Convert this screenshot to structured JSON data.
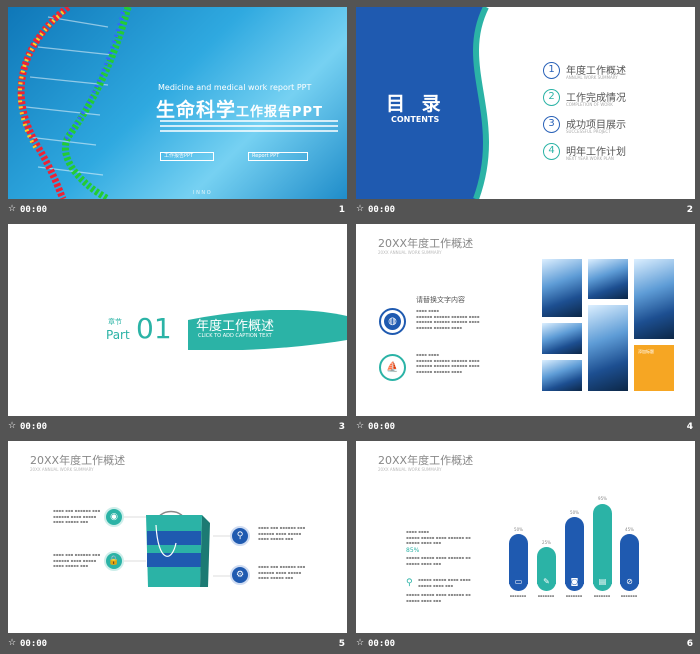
{
  "slides": [
    {
      "number": "1",
      "time": "00:00",
      "en_title": "Medicine and medical work report PPT",
      "zh_title_big": "生命科学",
      "zh_title_small": "工作报告PPT",
      "button_1": "工作报告PPT",
      "button_2": "Report PPT",
      "footer": "I N N O"
    },
    {
      "number": "2",
      "time": "00:00",
      "title": "目 录",
      "subtitle": "CONTENTS",
      "items": [
        {
          "num": "1",
          "label": "年度工作概述",
          "sub": "ANNUAL WORK SUMMARY"
        },
        {
          "num": "2",
          "label": "工作完成情况",
          "sub": "COMPLETION OF WORK"
        },
        {
          "num": "3",
          "label": "成功项目展示",
          "sub": "SUCCESSFUL PROJECT"
        },
        {
          "num": "4",
          "label": "明年工作计划",
          "sub": "NEXT YEAR WORK PLAN"
        }
      ]
    },
    {
      "number": "3",
      "time": "00:00",
      "chapter": "章节",
      "part": "Part",
      "part_num": "01",
      "title": "年度工作概述",
      "caption": "CLICK TO ADD CAPTION TEXT"
    },
    {
      "number": "4",
      "time": "00:00",
      "title": "20XX年度工作概述",
      "subtitle": "20XX ANNUAL WORK SUMMARY",
      "lead": "请替换文字内容",
      "side_text": "添加标题"
    },
    {
      "number": "5",
      "time": "00:00",
      "title": "20XX年度工作概述",
      "subtitle": "20XX ANNUAL WORK SUMMARY"
    },
    {
      "number": "6",
      "time": "00:00",
      "title": "20XX年度工作概述",
      "subtitle": "20XX ANNUAL WORK SUMMARY",
      "stat_label": "85%",
      "bar_labels": [
        "50%",
        "25%",
        "50%",
        "95%",
        "45%"
      ]
    }
  ],
  "colors": {
    "blue": "#1f5ab0",
    "teal": "#2bb3a6",
    "orange": "#f6a623",
    "frame": "#545454"
  },
  "icons": {
    "star": "star-icon"
  }
}
